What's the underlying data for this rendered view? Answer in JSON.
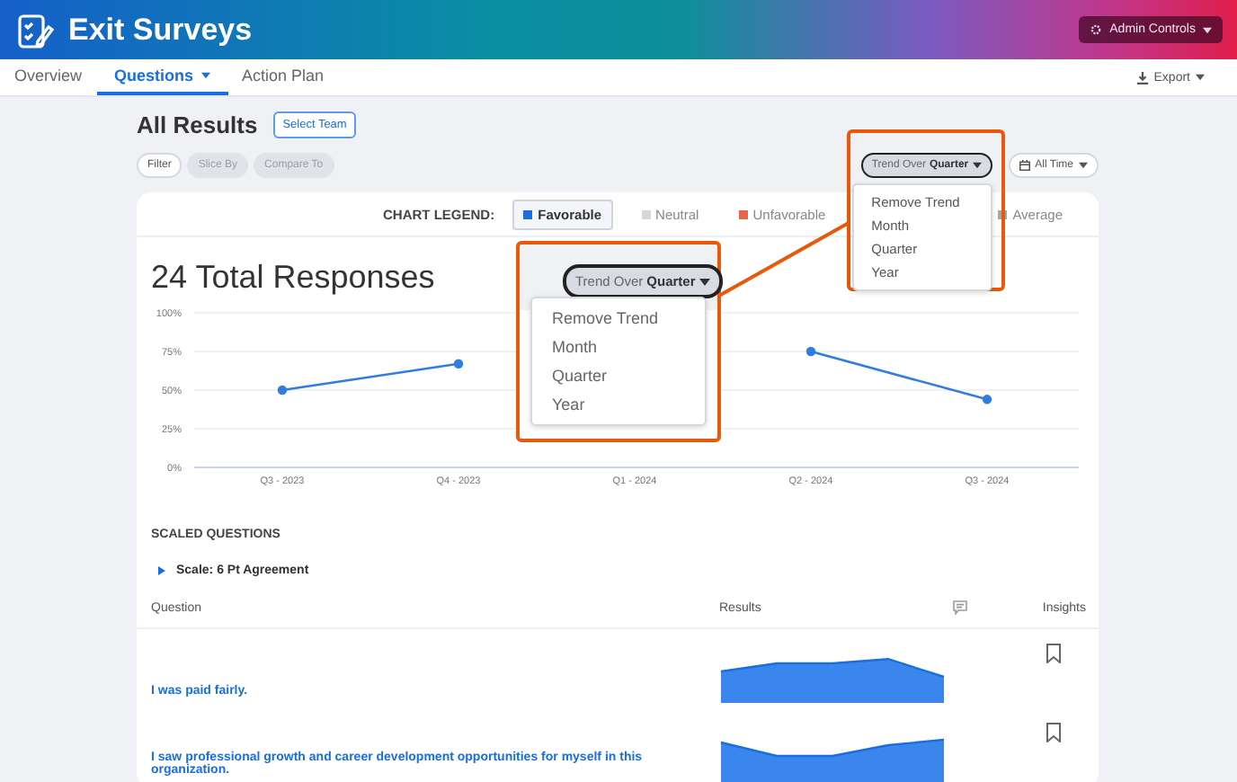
{
  "header": {
    "title": "Exit Surveys",
    "admin_button": "Admin Controls"
  },
  "nav": {
    "tabs": [
      {
        "label": "Overview",
        "selected": false,
        "dropdown": false
      },
      {
        "label": "Questions",
        "selected": true,
        "dropdown": true
      },
      {
        "label": "Action Plan",
        "selected": false,
        "dropdown": false
      }
    ],
    "export": "Export"
  },
  "page_title": "All Results",
  "select_team": "Select Team",
  "filters": [
    {
      "label": "Filter",
      "disabled": false
    },
    {
      "label": "Slice By",
      "disabled": true
    },
    {
      "label": "Compare To",
      "disabled": true
    }
  ],
  "trend_button": "Trend Over **Quarter**",
  "trend_menu": [
    "Remove Trend",
    "Month",
    "Quarter",
    "Year"
  ],
  "date_button": "All Time",
  "legend": {
    "label": "CHART LEGEND:",
    "items": [
      {
        "label": "Favorable",
        "color": "#1a6fe0",
        "selected": true
      },
      {
        "label": "Neutral",
        "color": "#d3d6dc",
        "selected": false
      },
      {
        "label": "Unfavorable",
        "color": "#e8644f",
        "selected": false
      },
      {
        "label": "Average",
        "color": "#a3a7ae",
        "selected": false
      }
    ]
  },
  "total_responses": "24 Total Responses",
  "chart_data": {
    "type": "line",
    "categories": [
      "Q3 - 2023",
      "Q4 - 2023",
      "Q1 - 2024",
      "Q2 - 2024",
      "Q3 - 2024"
    ],
    "series": [
      {
        "color": "#2f7de1",
        "values": [
          50,
          67,
          null,
          75,
          44
        ],
        "marker": true
      }
    ],
    "grid": true,
    "ylim": [
      0,
      100
    ],
    "yticks": [
      {
        "value": 0,
        "label": "0%"
      },
      {
        "value": 25,
        "label": "25%"
      },
      {
        "value": 50,
        "label": "50%"
      },
      {
        "value": 75,
        "label": "75%"
      },
      {
        "value": 100,
        "label": "100%"
      }
    ]
  },
  "callout": {
    "trend_button": "Trend Over **Quarter**",
    "menu": [
      "Remove Trend",
      "Month",
      "Quarter",
      "Year"
    ]
  },
  "section_title": "SCALED QUESTIONS",
  "scale": {
    "label": "Scale: 6 Pt Agreement",
    "expanded": false
  },
  "table": {
    "columns": [
      "Question",
      "Results",
      "Insights"
    ],
    "rows": [
      {
        "question": "I was paid fairly."
      },
      {
        "question": "I saw professional growth and career development opportunities for myself in this organization."
      }
    ]
  }
}
